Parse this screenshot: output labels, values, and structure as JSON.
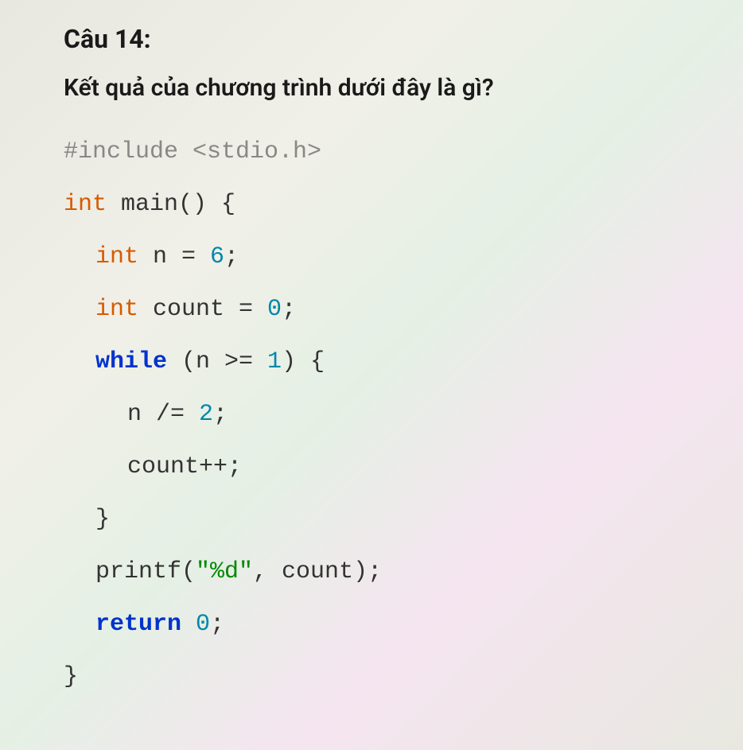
{
  "question": {
    "number": "Câu 14:",
    "text": "Kết quả của chương trình dưới đây là gì?"
  },
  "code": {
    "include": "#include <stdio.h>",
    "int1": "int",
    "main_sig": " main() {",
    "int2": "int",
    "n_decl": " n = ",
    "six": "6",
    "semi1": ";",
    "int3": "int",
    "count_decl": " count = ",
    "zero1": "0",
    "semi2": ";",
    "while_kw": "while",
    "while_cond_open": " (n >= ",
    "one": "1",
    "while_cond_close": ") {",
    "n_div": "n /= ",
    "two": "2",
    "semi3": ";",
    "count_inc": "count++;",
    "close_brace1": "}",
    "printf_call": "printf(",
    "format_str": "\"%d\"",
    "printf_args": ", count);",
    "return_kw": "return",
    "space": " ",
    "zero2": "0",
    "semi4": ";",
    "close_brace2": "}"
  }
}
